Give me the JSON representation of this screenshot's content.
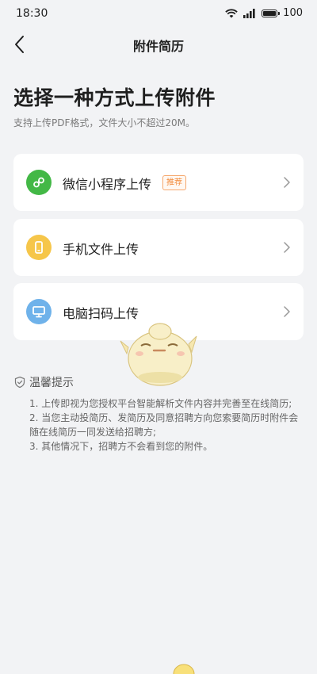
{
  "status_bar": {
    "time": "18:30",
    "battery_level": "100"
  },
  "nav": {
    "title": "附件简历"
  },
  "header": {
    "title": "选择一种方式上传附件",
    "subtitle": "支持上传PDF格式，文件大小不超过20M。"
  },
  "options": [
    {
      "label": "微信小程序上传",
      "badge": "推荐",
      "icon": "mini-program-icon",
      "icon_color": "#43b846"
    },
    {
      "label": "手机文件上传",
      "icon": "phone-icon",
      "icon_color": "#f6c64a"
    },
    {
      "label": "电脑扫码上传",
      "icon": "computer-icon",
      "icon_color": "#6fb2ea"
    }
  ],
  "tips": {
    "title": "温馨提示",
    "lines": [
      "1. 上传即视为您授权平台智能解析文件内容并完善至在线简历;",
      "2. 当您主动投简历、发简历及同意招聘方向您索要简历时附件会",
      "随在线简历一同发送给招聘方;",
      "3. 其他情况下，招聘方不会看到您的附件。"
    ]
  },
  "colors": {
    "background": "#f2f3f5",
    "badge": "#f28a3a"
  }
}
